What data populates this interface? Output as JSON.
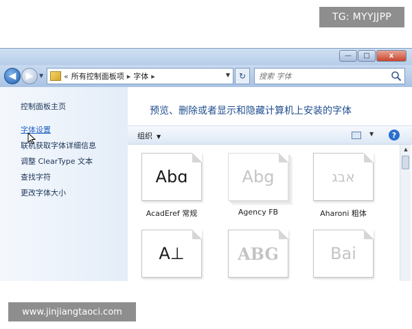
{
  "overlay": {
    "tg_label": "TG: MYYJJPP",
    "site_label": "www.jinjiangtaoci.com"
  },
  "window": {
    "title_buttons": {
      "minimize": "—",
      "maximize": "□",
      "close": "x"
    }
  },
  "navbar": {
    "breadcrumb": [
      "«",
      "所有控制面板项",
      "字体"
    ],
    "search_placeholder": "搜索 字体"
  },
  "sidebar": {
    "items": [
      {
        "label": "控制面板主页",
        "active": false
      },
      {
        "label": "字体设置",
        "active": true
      },
      {
        "label": "联机获取字体详细信息",
        "active": false
      },
      {
        "label": "调整 ClearType 文本",
        "active": false
      },
      {
        "label": "查找字符",
        "active": false
      },
      {
        "label": "更改字体大小",
        "active": false
      }
    ]
  },
  "main": {
    "heading": "预览、删除或者显示和隐藏计算机上安装的字体",
    "toolbar": {
      "organize_label": "组织"
    },
    "fonts": [
      {
        "sample": "Abɑ",
        "name": "AcadEref 常规",
        "hidden": false,
        "stack": false
      },
      {
        "sample": "Abg",
        "name": "Agency FB",
        "hidden": true,
        "stack": true
      },
      {
        "sample": "אבג",
        "name": "Aharoni 粗体",
        "hidden": true,
        "stack": false
      },
      {
        "sample": "A⊥",
        "name": "",
        "hidden": false,
        "stack": false
      },
      {
        "sample": "ABG",
        "name": "",
        "hidden": true,
        "stack": false
      },
      {
        "sample": "Bai",
        "name": "",
        "hidden": true,
        "stack": false
      }
    ]
  },
  "colors": {
    "heading": "#1f4d8f",
    "link_active": "#2563c4",
    "overlay_bg": "#8e8e8e"
  }
}
